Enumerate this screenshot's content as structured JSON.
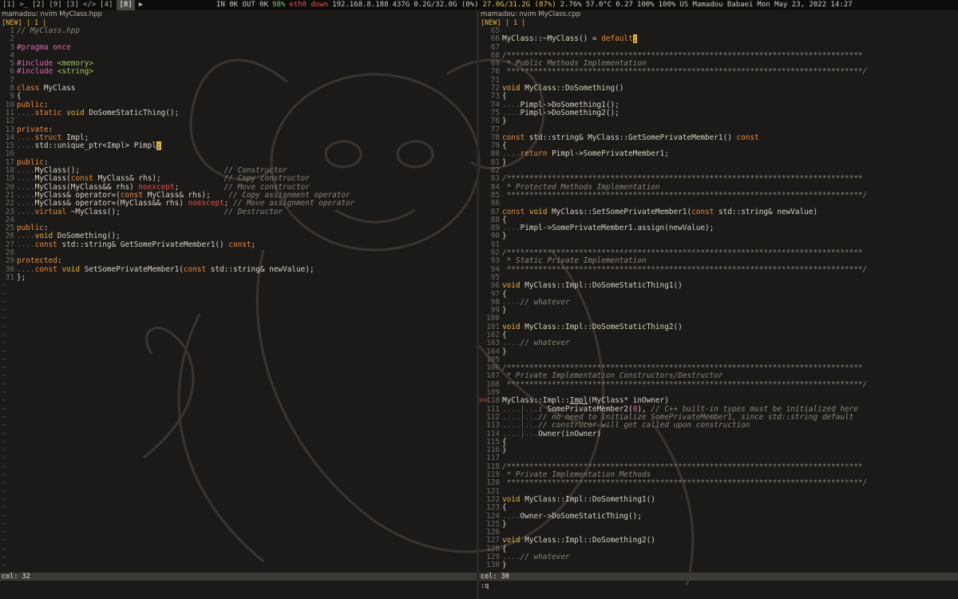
{
  "topbar": {
    "workspaces": [
      "[1]",
      ">_",
      "[2]",
      "[9]",
      "[3]",
      "</>",
      "[4]",
      "[8]",
      "▶"
    ],
    "stats": [
      {
        "text": "IN 0K OUT 0K",
        "cls": ""
      },
      {
        "text": "98%",
        "cls": "green"
      },
      {
        "text": "eth0 down",
        "cls": "red"
      },
      {
        "text": "192.168.8.188",
        "cls": ""
      },
      {
        "text": "437G",
        "cls": ""
      },
      {
        "text": "0.2G/32.0G (0%)",
        "cls": ""
      },
      {
        "text": "27.0G/31.2G (87%)",
        "cls": "yel"
      },
      {
        "text": "2.76%",
        "cls": ""
      },
      {
        "text": "57.0°C",
        "cls": ""
      },
      {
        "text": "0.27",
        "cls": ""
      },
      {
        "text": "100%",
        "cls": ""
      },
      {
        "text": "100%",
        "cls": ""
      },
      {
        "text": "US Mamadou Babaei",
        "cls": ""
      },
      {
        "text": "Mon May 23, 2022 14:27",
        "cls": ""
      }
    ]
  },
  "left": {
    "title": "mamadou: nvim MyClass.hpp",
    "tabline": "[NEW] | 1 |",
    "status": "col: 32",
    "lines": [
      {
        "n": "1",
        "h": "<span class='c'>// MyClass.hpp</span>"
      },
      {
        "n": "2",
        "h": ""
      },
      {
        "n": "3",
        "h": "<span class='p'>#pragma once</span>"
      },
      {
        "n": "4",
        "h": ""
      },
      {
        "n": "5",
        "h": "<span class='p'>#include</span> <span class='s'>&lt;memory&gt;</span>"
      },
      {
        "n": "6",
        "h": "<span class='p'>#include</span> <span class='s'>&lt;string&gt;</span>"
      },
      {
        "n": "7",
        "h": ""
      },
      {
        "n": "8",
        "h": "<span class='k'>class</span> MyClass"
      },
      {
        "n": "9",
        "h": "{"
      },
      {
        "n": "10",
        "h": "<span class='k'>public</span>:"
      },
      {
        "n": "11",
        "h": "<span class='d'>....</span><span class='k'>static</span> <span class='t'>void</span> DoSomeStaticThing();"
      },
      {
        "n": "12",
        "h": ""
      },
      {
        "n": "13",
        "h": "<span class='k'>private</span>:"
      },
      {
        "n": "14",
        "h": "<span class='d'>....</span><span class='k'>struct</span> Impl;"
      },
      {
        "n": "15",
        "h": "<span class='d'>....</span>std::unique_ptr&lt;Impl&gt; Pimpl<span class='cur'>;</span>"
      },
      {
        "n": "16",
        "h": ""
      },
      {
        "n": "17",
        "h": "<span class='k'>public</span>:"
      },
      {
        "n": "18",
        "h": "<span class='d'>....</span>MyClass();                                <span class='c'>// Constructor</span>"
      },
      {
        "n": "19",
        "h": "<span class='d'>....</span>MyClass(<span class='k'>const</span> MyClass&amp; rhs);              <span class='c'>// Copy constructor</span>"
      },
      {
        "n": "20",
        "h": "<span class='d'>....</span>MyClass(MyClass&amp;&amp; rhs) <span class='r'>noexcept</span>;          <span class='c'>// Move constructor</span>"
      },
      {
        "n": "21",
        "h": "<span class='d'>....</span>MyClass&amp; operator=(<span class='k'>const</span> MyClass&amp; rhs);    <span class='c'>// Copy assignment operator</span>"
      },
      {
        "n": "22",
        "h": "<span class='d'>....</span>MyClass&amp; operator=(MyClass&amp;&amp; rhs) <span class='r'>noexcept</span>; <span class='c'>// Move assignment operator</span>"
      },
      {
        "n": "23",
        "h": "<span class='d'>....</span><span class='k'>virtual</span> ~MyClass();                       <span class='c'>// Destructor</span>"
      },
      {
        "n": "24",
        "h": ""
      },
      {
        "n": "25",
        "h": "<span class='k'>public</span>:"
      },
      {
        "n": "26",
        "h": "<span class='d'>....</span><span class='t'>void</span> DoSomething();"
      },
      {
        "n": "27",
        "h": "<span class='d'>....</span><span class='k'>const</span> std::string&amp; GetSomePrivateMember1() <span class='k'>const</span>;"
      },
      {
        "n": "28",
        "h": ""
      },
      {
        "n": "29",
        "h": "<span class='k'>protected</span>:"
      },
      {
        "n": "30",
        "h": "<span class='d'>....</span><span class='k'>const</span> <span class='t'>void</span> SetSomePrivateMember1(<span class='k'>const</span> std::string&amp; newValue);"
      },
      {
        "n": "31",
        "h": "};"
      }
    ]
  },
  "right": {
    "title": "mamadou: nvim MyClass.cpp",
    "tabline": "[NEW] | 1 |",
    "status": "col: 30",
    "cmdline": ":q",
    "lines": [
      {
        "n": "65",
        "h": ""
      },
      {
        "n": "66",
        "h": "MyClass::~MyClass() = <span class='k'>default</span><span class='cur'>;</span>"
      },
      {
        "n": "67",
        "h": ""
      },
      {
        "n": "68",
        "h": "<span class='c'>/*******************************************************************************</span>"
      },
      {
        "n": "69",
        "h": "<span class='c'> * Public Methods Implementation</span>"
      },
      {
        "n": "70",
        "h": "<span class='c'> *******************************************************************************/</span>"
      },
      {
        "n": "71",
        "h": ""
      },
      {
        "n": "72",
        "h": "<span class='t'>void</span> MyClass::DoSomething()"
      },
      {
        "n": "73",
        "h": "{"
      },
      {
        "n": "74",
        "h": "<span class='d'>....</span>Pimpl-&gt;DoSomething1();"
      },
      {
        "n": "75",
        "h": "<span class='d'>....</span>Pimpl-&gt;DoSomething2();"
      },
      {
        "n": "76",
        "h": "}"
      },
      {
        "n": "77",
        "h": ""
      },
      {
        "n": "78",
        "h": "<span class='k'>const</span> std::string&amp; MyClass::GetSomePrivateMember1() <span class='k'>const</span>"
      },
      {
        "n": "79",
        "h": "{"
      },
      {
        "n": "80",
        "h": "<span class='d'>....</span><span class='k'>return</span> Pimpl-&gt;SomePrivateMember1;"
      },
      {
        "n": "81",
        "h": "}"
      },
      {
        "n": "82",
        "h": ""
      },
      {
        "n": "83",
        "h": "<span class='c'>/*******************************************************************************</span>"
      },
      {
        "n": "84",
        "h": "<span class='c'> * Protected Methods Implementation</span>"
      },
      {
        "n": "85",
        "h": "<span class='c'> *******************************************************************************/</span>"
      },
      {
        "n": "86",
        "h": ""
      },
      {
        "n": "87",
        "h": "<span class='k'>const</span> <span class='t'>void</span> MyClass::SetSomePrivateMember1(<span class='k'>const</span> std::string&amp; newValue)"
      },
      {
        "n": "88",
        "h": "{"
      },
      {
        "n": "89",
        "h": "<span class='d'>....</span>Pimpl-&gt;SomePrivateMember1.assign(newValue);"
      },
      {
        "n": "90",
        "h": "}"
      },
      {
        "n": "91",
        "h": ""
      },
      {
        "n": "92",
        "h": "<span class='c'>/*******************************************************************************</span>"
      },
      {
        "n": "93",
        "h": "<span class='c'> * Static Private Implementation</span>"
      },
      {
        "n": "94",
        "h": "<span class='c'> *******************************************************************************/</span>"
      },
      {
        "n": "95",
        "h": ""
      },
      {
        "n": "96",
        "h": "<span class='t'>void</span> MyClass::Impl::DoSomeStaticThing1()"
      },
      {
        "n": "97",
        "h": "{"
      },
      {
        "n": "98",
        "h": "<span class='d'>....</span><span class='c'>// whatever</span>"
      },
      {
        "n": "99",
        "h": "}"
      },
      {
        "n": "100",
        "h": ""
      },
      {
        "n": "101",
        "h": "<span class='t'>void</span> MyClass::Impl::DoSomeStaticThing2()"
      },
      {
        "n": "102",
        "h": "{"
      },
      {
        "n": "103",
        "h": "<span class='d'>....</span><span class='c'>// whatever</span>"
      },
      {
        "n": "104",
        "h": "}"
      },
      {
        "n": "105",
        "h": ""
      },
      {
        "n": "106",
        "h": "<span class='c'>/*******************************************************************************</span>"
      },
      {
        "n": "107",
        "h": "<span class='c'> * Private Implementation Constructors/Destructor</span>"
      },
      {
        "n": "108",
        "h": "<span class='c'> *******************************************************************************/</span>"
      },
      {
        "n": "109",
        "h": ""
      },
      {
        "n": "110",
        "h": "MyClass::Impl::<u>Impl</u>(MyClass* inOwner)",
        "sign": "&gt;&gt;"
      },
      {
        "n": "111",
        "h": "<span class='d'>....|...</span>: SomePrivateMember2(<span class='p'>0</span>), <span class='c'>// C++ built-in types must be initialized here</span>"
      },
      {
        "n": "112",
        "h": "<span class='d'>....|...</span><span class='c'>// no need to initialize SomePrivateMember1, since std::string default</span>"
      },
      {
        "n": "113",
        "h": "<span class='d'>....|...</span><span class='c'>// construcor will get called upon construction</span>"
      },
      {
        "n": "114",
        "h": "<span class='d'>....|...</span>Owner(inOwner)"
      },
      {
        "n": "115",
        "h": "{"
      },
      {
        "n": "116",
        "h": "}"
      },
      {
        "n": "117",
        "h": ""
      },
      {
        "n": "118",
        "h": "<span class='c'>/*******************************************************************************</span>"
      },
      {
        "n": "119",
        "h": "<span class='c'> * Private Implementation Methods</span>"
      },
      {
        "n": "120",
        "h": "<span class='c'> *******************************************************************************/</span>"
      },
      {
        "n": "121",
        "h": ""
      },
      {
        "n": "122",
        "h": "<span class='t'>void</span> MyClass::Impl::DoSomething1()"
      },
      {
        "n": "123",
        "h": "{"
      },
      {
        "n": "124",
        "h": "<span class='d'>....</span>Owner-&gt;DoSomeStaticThing();"
      },
      {
        "n": "125",
        "h": "}"
      },
      {
        "n": "126",
        "h": ""
      },
      {
        "n": "127",
        "h": "<span class='t'>void</span> MyClass::Impl::DoSomething2()"
      },
      {
        "n": "128",
        "h": "{"
      },
      {
        "n": "129",
        "h": "<span class='d'>....</span><span class='c'>// whatever</span>"
      },
      {
        "n": "130",
        "h": "}"
      }
    ]
  }
}
